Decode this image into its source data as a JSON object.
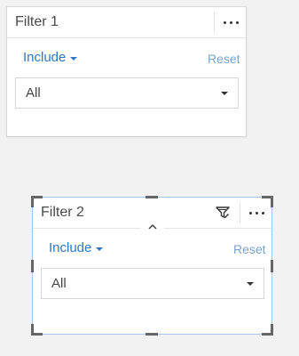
{
  "filters": [
    {
      "title": "Filter 1",
      "include_label": "Include",
      "reset_label": "Reset",
      "select_value": "All"
    },
    {
      "title": "Filter 2",
      "include_label": "Include",
      "reset_label": "Reset",
      "select_value": "All"
    }
  ],
  "icons": {
    "more": "more-horizontal-icon",
    "include_dropdown": "caret-down-icon",
    "select_dropdown": "caret-down-icon",
    "filter_edit": "filter-edit-icon",
    "collapse": "chevron-up-icon"
  },
  "colors": {
    "link_blue": "#2f78c4",
    "reset_blue": "#7aa3cf",
    "text_dark": "#4a4a4a",
    "border": "#d8d8d8",
    "selection_border": "#a8c8ea",
    "handle": "#666666",
    "background": "#f2f2f2"
  }
}
